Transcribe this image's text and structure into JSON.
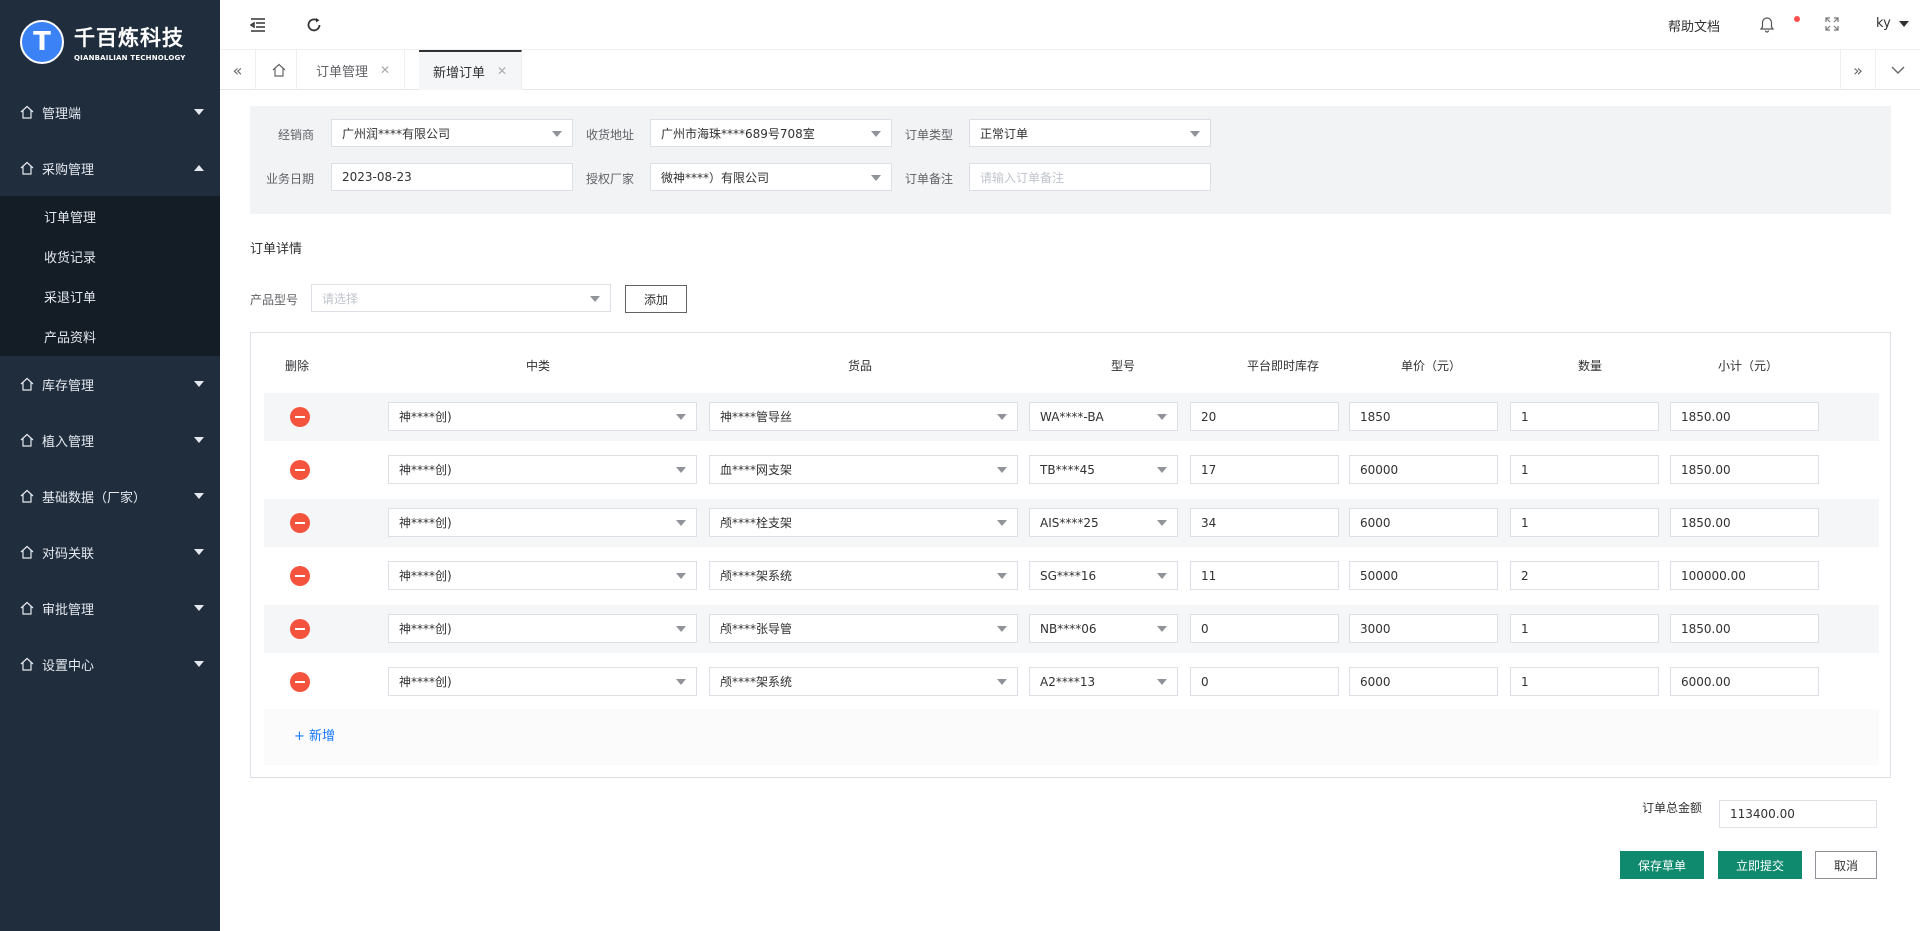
{
  "brand": {
    "name_cn": "千百炼科技",
    "name_en": "QIANBAILIAN TECHNOLOGY",
    "mark": "T"
  },
  "sidebar": {
    "items": [
      {
        "label": "管理端",
        "expanded": false
      },
      {
        "label": "采购管理",
        "expanded": true
      },
      {
        "label": "库存管理",
        "expanded": false
      },
      {
        "label": "植入管理",
        "expanded": false
      },
      {
        "label": "基础数据（厂家）",
        "expanded": false
      },
      {
        "label": "对码关联",
        "expanded": false
      },
      {
        "label": "审批管理",
        "expanded": false
      },
      {
        "label": "设置中心",
        "expanded": false
      }
    ],
    "subitems": [
      "订单管理",
      "收货记录",
      "采退订单",
      "产品资料"
    ]
  },
  "header": {
    "help": "帮助文档",
    "user": "ky"
  },
  "tabs": [
    {
      "label": "订单管理",
      "active": false
    },
    {
      "label": "新增订单",
      "active": true
    }
  ],
  "form": {
    "dealer": {
      "label": "经销商",
      "value": "广州润****有限公司"
    },
    "address": {
      "label": "收货地址",
      "value": "广州市海珠****689号708室"
    },
    "order_type": {
      "label": "订单类型",
      "value": "正常订单"
    },
    "date": {
      "label": "业务日期",
      "value": "2023-08-23"
    },
    "factory": {
      "label": "授权厂家",
      "value": "微神****）有限公司"
    },
    "remark": {
      "label": "订单备注",
      "placeholder": "请输入订单备注"
    }
  },
  "details": {
    "title": "订单详情",
    "product_label": "产品型号",
    "product_placeholder": "请选择",
    "add_button": "添加",
    "columns": [
      "删除",
      "中类",
      "货品",
      "型号",
      "平台即时库存",
      "单价（元）",
      "数量",
      "小计（元）"
    ],
    "rows": [
      {
        "category": "神****创)",
        "goods": "神****管导丝",
        "model": "WA****-BA",
        "stock": "20",
        "price": "1850",
        "qty": "1",
        "subtotal": "1850.00"
      },
      {
        "category": "神****创)",
        "goods": "血****网支架",
        "model": "TB****45",
        "stock": "17",
        "price": "60000",
        "qty": "1",
        "subtotal": "1850.00"
      },
      {
        "category": "神****创)",
        "goods": "颅****栓支架",
        "model": "AIS****25",
        "stock": "34",
        "price": "6000",
        "qty": "1",
        "subtotal": "1850.00"
      },
      {
        "category": "神****创)",
        "goods": "颅****架系统",
        "model": "SG****16",
        "stock": "11",
        "price": "50000",
        "qty": "2",
        "subtotal": "100000.00"
      },
      {
        "category": "神****创)",
        "goods": "颅****张导管",
        "model": "NB****06",
        "stock": "0",
        "price": "3000",
        "qty": "1",
        "subtotal": "1850.00"
      },
      {
        "category": "神****创)",
        "goods": "颅****架系统",
        "model": "A2****13",
        "stock": "0",
        "price": "6000",
        "qty": "1",
        "subtotal": "6000.00"
      }
    ],
    "add_row": "+ 新增"
  },
  "footer": {
    "total_label": "订单总金额",
    "total_value": "113400.00",
    "save_draft": "保存草单",
    "submit": "立即提交",
    "cancel": "取消"
  },
  "colors": {
    "sidebar": "#1f2d3d",
    "primary": "#0f8a6e",
    "danger": "#f4533d",
    "link": "#1677ff"
  }
}
